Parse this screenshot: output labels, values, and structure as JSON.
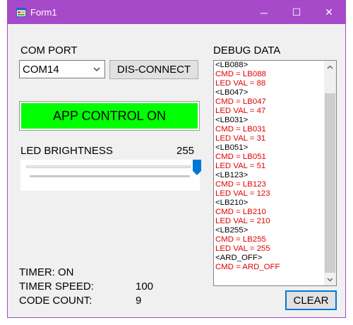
{
  "window": {
    "title": "Form1",
    "icons": {
      "app": "form-app-icon",
      "minimize": "minimize-icon",
      "maximize": "maximize-icon",
      "close": "close-icon"
    },
    "buttons": {
      "minimize": "─",
      "maximize": "☐",
      "close": "✕"
    }
  },
  "com": {
    "label": "COM PORT",
    "selected": "COM14",
    "disconnect_label": "DIS-CONNECT"
  },
  "app_control": {
    "label": "APP CONTROL ON",
    "color": "#00ff00"
  },
  "led": {
    "label": "LED BRIGHTNESS",
    "value": "255",
    "slider_min": 0,
    "slider_max": 255,
    "slider_value": 255
  },
  "timer": {
    "status": "TIMER: ON",
    "speed_label": "TIMER SPEED:",
    "speed_value": "100",
    "code_count_label": "CODE COUNT:",
    "code_count_value": "9"
  },
  "debug": {
    "label": "DEBUG DATA",
    "lines": [
      {
        "text": "<LB088>",
        "color": "#000000"
      },
      {
        "text": "CMD = LB088",
        "color": "#e00000"
      },
      {
        "text": "LED VAL = 88",
        "color": "#e00000"
      },
      {
        "text": "<LB047>",
        "color": "#000000"
      },
      {
        "text": "CMD = LB047",
        "color": "#e00000"
      },
      {
        "text": "LED VAL = 47",
        "color": "#e00000"
      },
      {
        "text": "<LB031>",
        "color": "#000000"
      },
      {
        "text": "CMD = LB031",
        "color": "#e00000"
      },
      {
        "text": "LED VAL = 31",
        "color": "#e00000"
      },
      {
        "text": "<LB051>",
        "color": "#000000"
      },
      {
        "text": "CMD = LB051",
        "color": "#e00000"
      },
      {
        "text": "LED VAL = 51",
        "color": "#e00000"
      },
      {
        "text": "<LB123>",
        "color": "#000000"
      },
      {
        "text": "CMD = LB123",
        "color": "#e00000"
      },
      {
        "text": "LED VAL = 123",
        "color": "#e00000"
      },
      {
        "text": "<LB210>",
        "color": "#000000"
      },
      {
        "text": "CMD = LB210",
        "color": "#e00000"
      },
      {
        "text": "LED VAL = 210",
        "color": "#e00000"
      },
      {
        "text": "<LB255>",
        "color": "#000000"
      },
      {
        "text": "CMD = LB255",
        "color": "#e00000"
      },
      {
        "text": "LED VAL = 255",
        "color": "#e00000"
      },
      {
        "text": "<ARD_OFF>",
        "color": "#000000"
      },
      {
        "text": "CMD = ARD_OFF",
        "color": "#e00000"
      }
    ],
    "clear_label": "CLEAR"
  },
  "colors": {
    "titlebar": "#a64ac9",
    "accent": "#0078d7",
    "debug_response": "#e00000"
  }
}
